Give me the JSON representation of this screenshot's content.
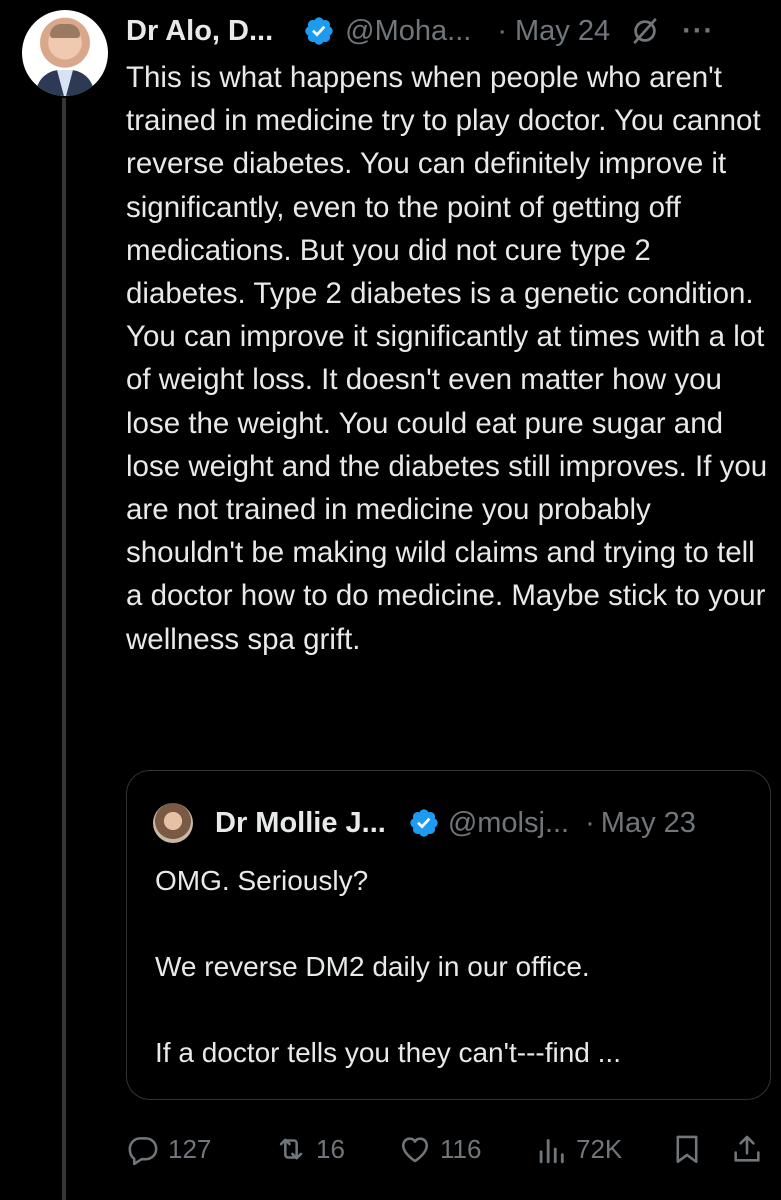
{
  "tweet": {
    "author_name": "Dr Alo, D...",
    "handle": "@Moha...",
    "separator": "·",
    "date": "May 24",
    "more_label": "···",
    "text": "This is what happens when people who aren't trained in medicine try to play doctor. You cannot reverse diabetes. You can definitely improve it significantly, even to the point of getting off medications. But you did not cure type 2 diabetes. Type 2 diabetes is a genetic condition. You can improve it significantly at times with a lot of weight loss. It doesn't even matter how you lose the weight. You could eat pure sugar and lose weight and the diabetes still improves. If you are not trained in medicine you probably shouldn't be making wild claims and trying to tell a doctor how to do medicine. Maybe stick to your wellness spa grift."
  },
  "quoted": {
    "author_name": "Dr Mollie J...",
    "handle": "@molsj...",
    "separator": "·",
    "date": "May 23",
    "lines": [
      "OMG. Seriously?",
      "We reverse DM2 daily in our office.",
      "If a doctor tells you they can't---find ..."
    ]
  },
  "actions": {
    "replies": "127",
    "reposts": "16",
    "likes": "116",
    "views": "72K"
  },
  "icons": {
    "verified": "verified-badge-icon",
    "grok": "grok-icon",
    "reply": "reply-icon",
    "repost": "repost-icon",
    "like": "heart-icon",
    "views": "views-icon",
    "bookmark": "bookmark-icon",
    "share": "share-icon"
  },
  "colors": {
    "background": "#000000",
    "text": "#e7e9ea",
    "muted": "#71767b",
    "verified": "#1d9bf0",
    "border": "#2f3336"
  }
}
